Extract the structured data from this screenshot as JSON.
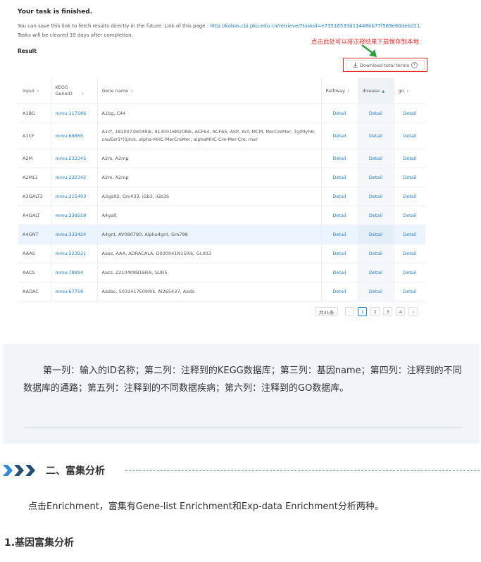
{
  "task": {
    "title": "Your task is finished.",
    "desc_prefix": "You can save this link to fetch results directly in the future. Link of this page :",
    "link": "http://kobas.cbi.pku.edu.cn/retrieve/?taskid=e73516533d11448bb77f569e60debd11",
    "desc_suffix": ". Tasks will be cleared 10 days after completion.",
    "result_label": "Result"
  },
  "annotation": "点击此处可以将注释结果下载保存到本地",
  "download_button": "Download total terms",
  "table": {
    "headers": [
      "Input",
      "KEGG GeneID",
      "Gene name",
      "Pathway",
      "disease",
      "go"
    ],
    "rows": [
      [
        "A1BG",
        "mmu:117586",
        "A1bg, C44",
        "Detail",
        "Detail",
        "Detail"
      ],
      [
        "A1CF",
        "mmu:69865",
        "A1cf, 1810073H04Rik, 9130016M20Rik, ACF64, ACF65, ASP, Acf, MCM, MerCreMer, Tg(Myh6-cre/Esr1*)1Jmk, alpha-MHC-MerCreMer, alphaMHC-Cre-Mer-Cre, mer",
        "Detail",
        "Detail",
        "Detail"
      ],
      [
        "A2M",
        "mmu:232345",
        "A2m, A2mp",
        "Detail",
        "Detail",
        "Detail"
      ],
      [
        "A2ML1",
        "mmu:232345",
        "A2m, A2mp",
        "Detail",
        "Detail",
        "Detail"
      ],
      [
        "A3GALT2",
        "mmu:215493",
        "A3galt2, Gm433, iGb3, iGb3S",
        "Detail",
        "Detail",
        "Detail"
      ],
      [
        "A4GALT",
        "mmu:239559",
        "A4galt",
        "Detail",
        "Detail",
        "Detail"
      ],
      [
        "A4GNT",
        "mmu:333424",
        "A4gnt, AV080780, Alpha4gnt, Gm798",
        "Detail",
        "Detail",
        "Detail"
      ],
      [
        "AAAS",
        "mmu:223921",
        "Aaas, AAA, ADRACALA, D030041N15Rik, GL003",
        "Detail",
        "Detail",
        "Detail"
      ],
      [
        "AACS",
        "mmu:78894",
        "Aacs, 2210408B16Rik, SUR5",
        "Detail",
        "Detail",
        "Detail"
      ],
      [
        "AADAC",
        "mmu:67758",
        "Aadac, 5033417E09Rik, AI265437, Aada",
        "Detail",
        "Detail",
        "Detail"
      ]
    ]
  },
  "pagination": {
    "total": "共31条",
    "prev": "‹",
    "pages": [
      "1",
      "2",
      "3",
      "4"
    ],
    "next": "›",
    "current": "1"
  },
  "note": "第一列：输入的ID名称；第二列：注释到的KEGG数据库；第三列：基因name；第四列：注释到的不同数据库的通路；第五列：注释到的不同数据疾病；第六列：注释到的GO数据库。",
  "section": {
    "title": "二、富集分析"
  },
  "paragraph": "点击Enrichment，富集有Gene-list Enrichment和Exp-data Enrichment分析两种。",
  "subheading": "1.基因富集分析",
  "colors": {
    "link": "#1f7ed0",
    "annotation": "#e0302a",
    "highlight_row": "#ecf5ff",
    "note_bg": "#f1f5fa",
    "chevron": "#3c6f9b"
  },
  "icons": {
    "download": "download-icon",
    "help": "question-circle-icon",
    "sort": "sort-icon",
    "section": "triple-chevron-icon"
  }
}
